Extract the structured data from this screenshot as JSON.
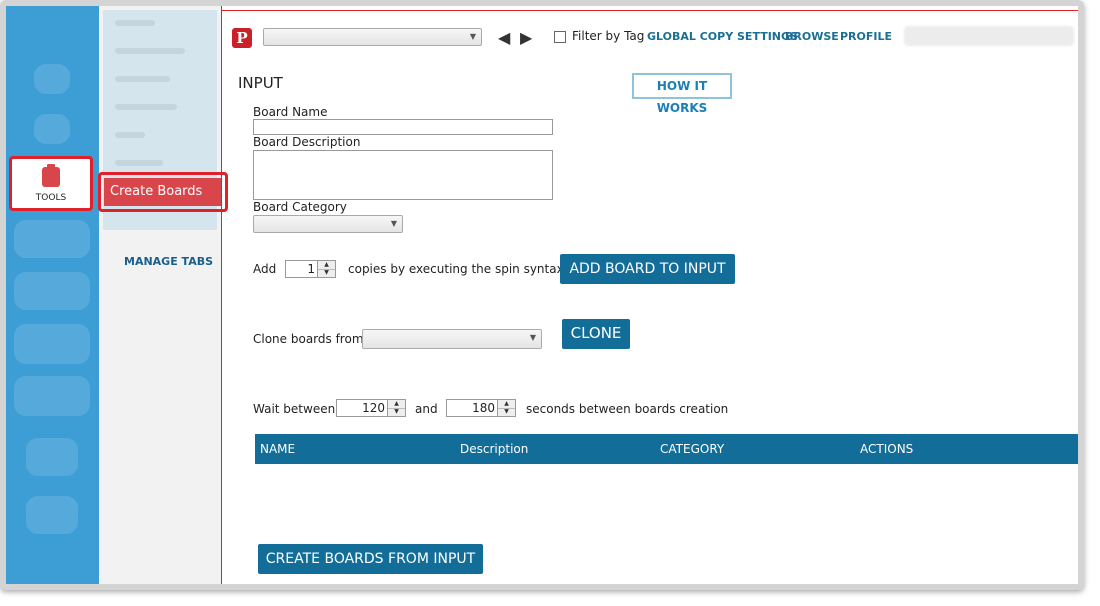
{
  "leftbar": {
    "tools_label": "TOOLS"
  },
  "subnav": {
    "active_item": "Create Boards",
    "manage_tabs": "MANAGE TABS"
  },
  "topbar": {
    "filter_label": "Filter by Tag",
    "links": [
      "GLOBAL COPY SETTINGS",
      "BROWSE",
      "PROFILE"
    ],
    "account_select_value": ""
  },
  "form": {
    "section_title": "INPUT",
    "how_it_works": "HOW IT WORKS",
    "board_name_label": "Board Name",
    "board_name_value": "",
    "board_description_label": "Board Description",
    "board_description_value": "",
    "board_category_label": "Board Category",
    "board_category_value": "",
    "add_label": "Add",
    "copies_value": "1",
    "copies_text": "copies by executing the spin syntax",
    "add_board_button": "ADD BOARD TO INPUT",
    "clone_label": "Clone boards from",
    "clone_value": "",
    "clone_button": "CLONE",
    "wait_label": "Wait between",
    "wait_min": "120",
    "and_label": "and",
    "wait_max": "180",
    "wait_suffix": "seconds between boards creation"
  },
  "table": {
    "columns": [
      "NAME",
      "Description",
      "CATEGORY",
      "ACTIONS"
    ],
    "rows": []
  },
  "footer": {
    "create_button": "CREATE BOARDS FROM INPUT"
  },
  "colors": {
    "sidebar": "#3d9ed6",
    "accent_red": "#d8464b",
    "highlight_border": "#e0202a",
    "primary_blue": "#126d99",
    "link": "#1a6f94"
  }
}
